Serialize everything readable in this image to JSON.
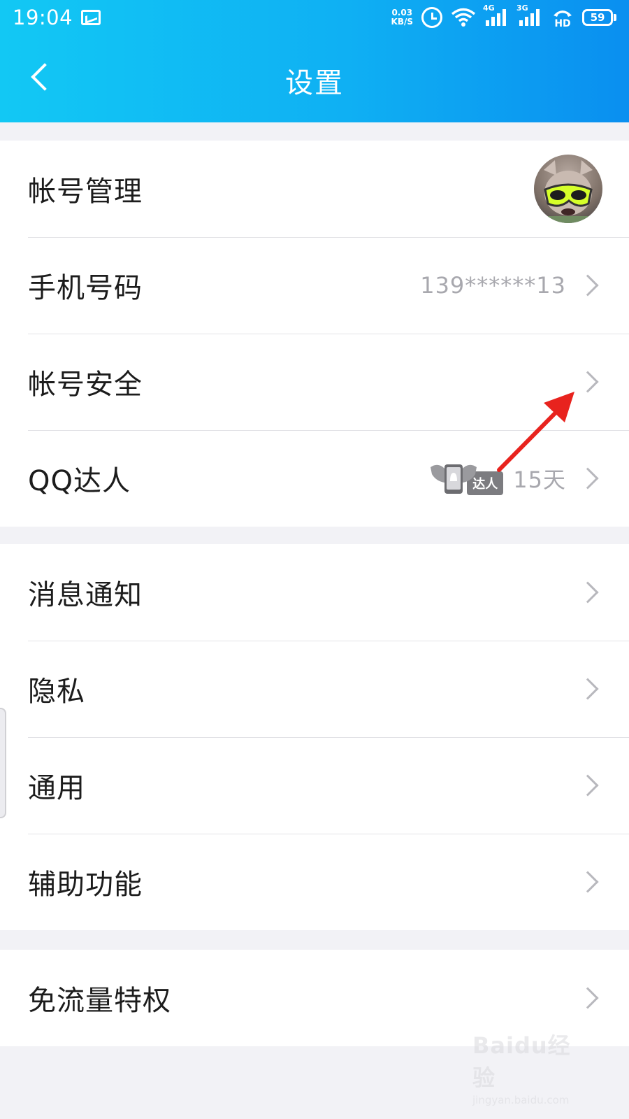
{
  "status_bar": {
    "time": "19:04",
    "net_speed_value": "0.03",
    "net_speed_unit": "KB/S",
    "signal1_tag": "4G",
    "signal2_tag": "3G",
    "hd_label": "HD",
    "battery": "59"
  },
  "nav": {
    "title": "设置"
  },
  "account_group": {
    "account_manage": "帐号管理",
    "phone_label": "手机号码",
    "phone_value": "139******13",
    "security_label": "帐号安全",
    "qq_daren_label": "QQ达人",
    "daren_badge": "达人",
    "daren_days": "15天"
  },
  "general_group": {
    "notifications": "消息通知",
    "privacy": "隐私",
    "general": "通用",
    "accessibility": "辅助功能"
  },
  "extra_group": {
    "free_data": "免流量特权"
  },
  "watermark": {
    "logo": "Baidu经验",
    "url": "jingyan.baidu.com"
  },
  "colors": {
    "header_start": "#12c8f4",
    "header_end": "#0a8ff0",
    "annotation_arrow": "#e8231e"
  }
}
